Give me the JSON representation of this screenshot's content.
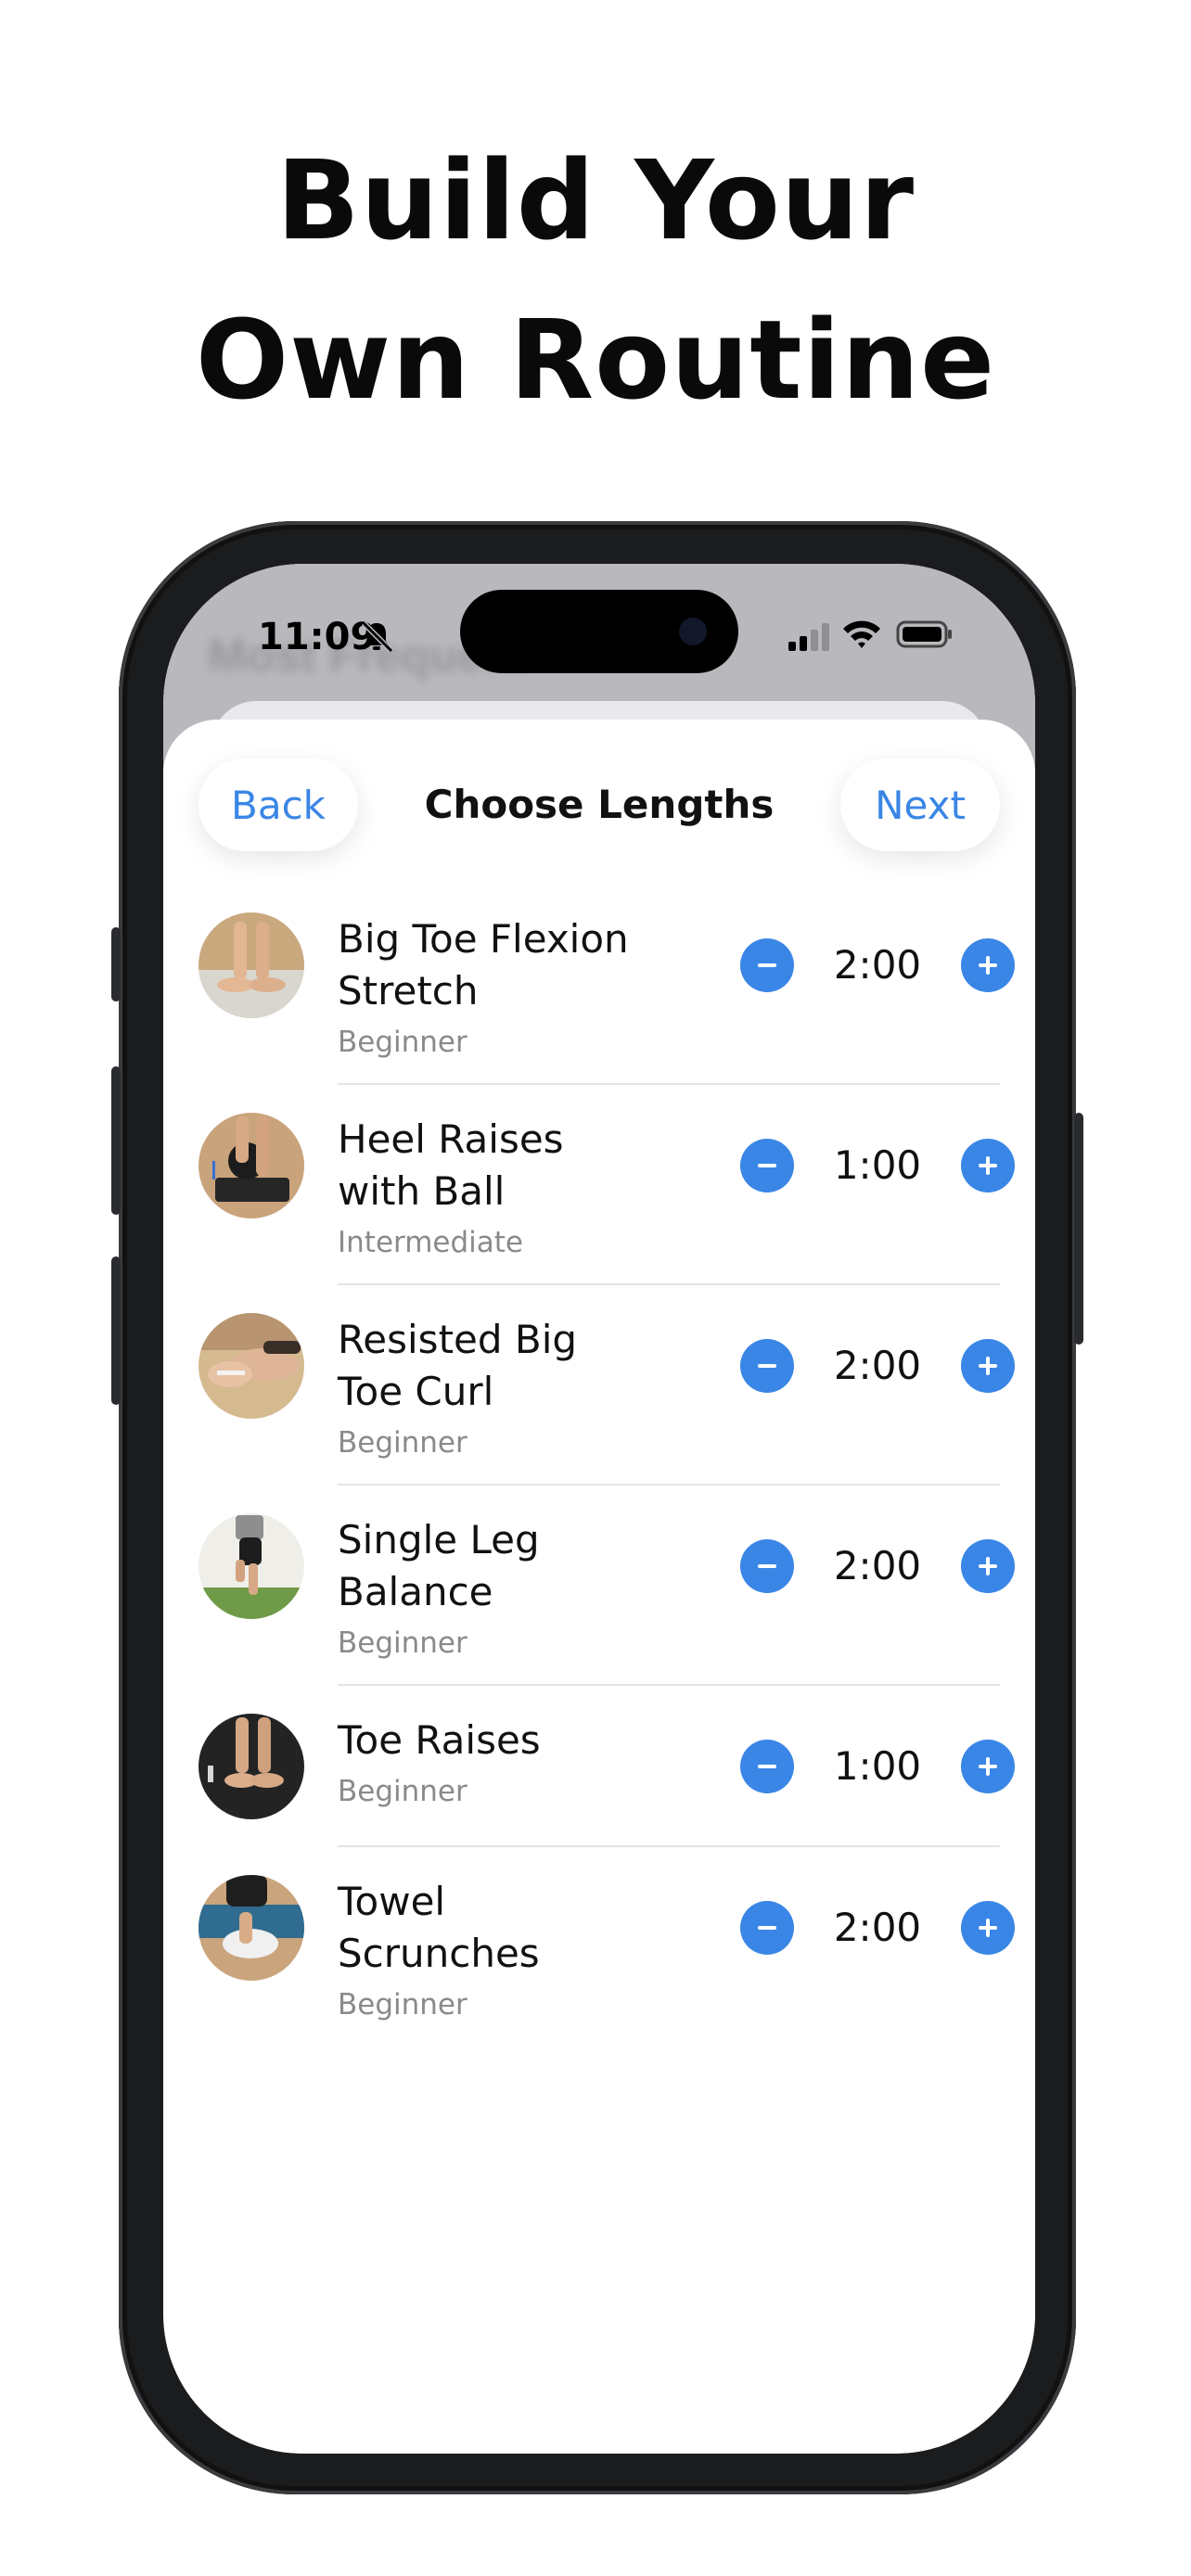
{
  "headline": {
    "line1": "Build Your",
    "line2": "Own Routine"
  },
  "status_bar": {
    "time": "11:09"
  },
  "background_title": "Most Frequent",
  "header": {
    "back_label": "Back",
    "title": "Choose Lengths",
    "next_label": "Next"
  },
  "colors": {
    "accent": "#3a86e6",
    "secondary_text": "#8a8a8e"
  },
  "exercises": [
    {
      "title_line1": "Big Toe Flexion",
      "title_line2": "Stretch",
      "level": "Beginner",
      "duration": "2:00"
    },
    {
      "title_line1": "Heel Raises",
      "title_line2": "with Ball",
      "level": "Intermediate",
      "duration": "1:00"
    },
    {
      "title_line1": "Resisted Big",
      "title_line2": "Toe Curl",
      "level": "Beginner",
      "duration": "2:00"
    },
    {
      "title_line1": "Single Leg",
      "title_line2": "Balance",
      "level": "Beginner",
      "duration": "2:00"
    },
    {
      "title_line1": "Toe Raises",
      "title_line2": "",
      "level": "Beginner",
      "duration": "1:00"
    },
    {
      "title_line1": "Towel",
      "title_line2": "Scrunches",
      "level": "Beginner",
      "duration": "2:00"
    }
  ]
}
